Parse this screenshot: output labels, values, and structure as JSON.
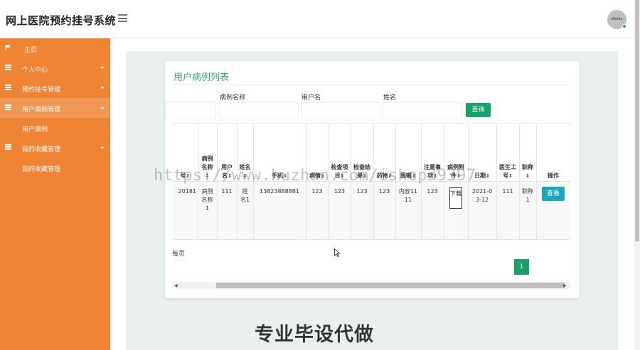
{
  "app": {
    "title": "网上医院预约挂号系统",
    "avatar_text": "Works"
  },
  "sidebar": {
    "home": "主页",
    "items": [
      {
        "label": "个人中心",
        "expanded": false
      },
      {
        "label": "预约挂号管理",
        "expanded": false
      },
      {
        "label": "用户病例管理",
        "expanded": true,
        "sub": "用户病例"
      },
      {
        "label": "我的收藏管理",
        "expanded": true,
        "sub": "我的收藏管理"
      }
    ]
  },
  "page": {
    "title": "用户病例列表",
    "search": {
      "case_name_label": "病例名称",
      "username_label": "用户名",
      "name_label": "姓名",
      "button": "查询"
    },
    "table": {
      "headers": [
        "号",
        "病例名称",
        "用户名",
        "姓名",
        "手机",
        "病情",
        "检查项目",
        "检查结果",
        "药物",
        "医嘱",
        "注意事项",
        "病例附件",
        "日期",
        "医生工号",
        "职称",
        "操作"
      ],
      "row": {
        "id": "20181",
        "case_name": "病例名称1",
        "username": "111",
        "name": "姓名1",
        "phone": "13823888881",
        "condition": "123",
        "exam_item": "123",
        "exam_result": "123",
        "medicine": "123",
        "advice": "内容1111",
        "notes": "123",
        "attachment": "下载",
        "date": "2021-03-12",
        "doctor_id": "111",
        "title": "职称1",
        "action": "查看"
      }
    },
    "per_page": "每页",
    "current_page": "1"
  },
  "watermark": {
    "url": "https://www.huzhan.com/ishop39397",
    "ad": "专业毕设代做"
  }
}
